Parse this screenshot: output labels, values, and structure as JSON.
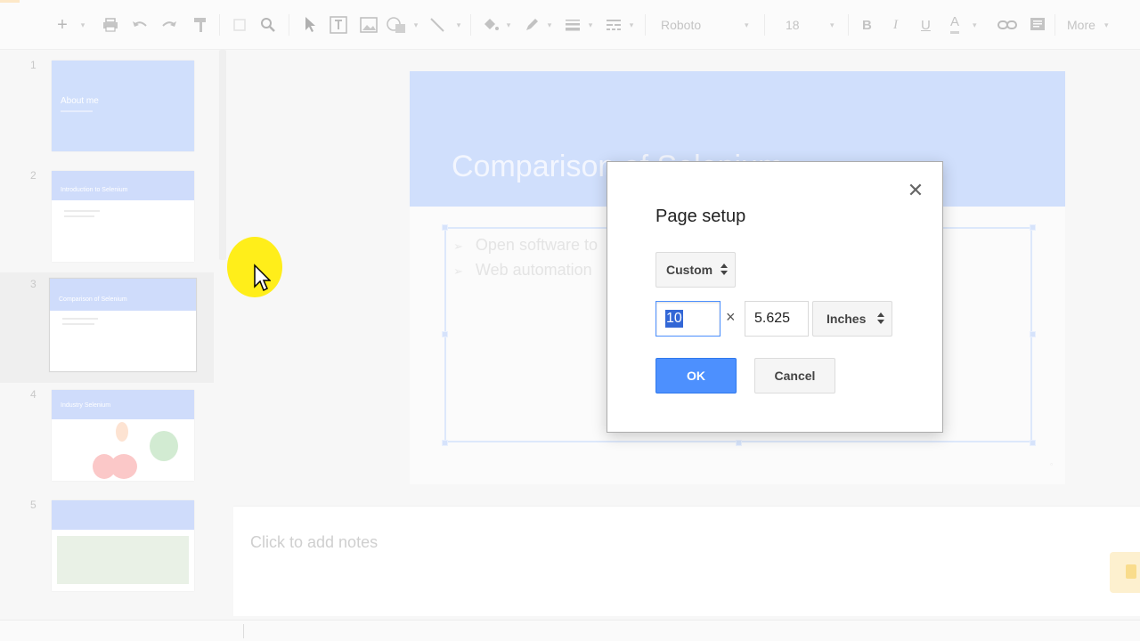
{
  "toolbar": {
    "font_name": "Roboto",
    "font_size": "18",
    "bold_label": "B",
    "italic_label": "I",
    "underline_label": "U",
    "textcolor_label": "A",
    "more_label": "More",
    "icons": [
      "new-slide-icon",
      "print-icon",
      "undo-icon",
      "redo-icon",
      "paint-format-icon",
      "fit-icon",
      "zoom-icon",
      "select-icon",
      "textbox-icon",
      "image-icon",
      "shape-icon",
      "line-icon",
      "fill-color-icon",
      "border-color-icon",
      "border-weight-icon",
      "border-dash-icon",
      "link-icon",
      "comment-icon"
    ]
  },
  "filmstrip": {
    "slides": [
      {
        "number": "1",
        "title": "About me"
      },
      {
        "number": "2",
        "title": "Introduction to Selenium"
      },
      {
        "number": "3",
        "title": "Comparison of Selenium"
      },
      {
        "number": "4",
        "title": "Industry Selenium"
      },
      {
        "number": "5",
        "title": ""
      }
    ],
    "selected_index": 2
  },
  "slide": {
    "title": "Comparison of Selenium",
    "bullets": [
      "Open software to",
      "Web automation"
    ]
  },
  "notes": {
    "placeholder": "Click to add notes"
  },
  "dialog": {
    "title": "Page setup",
    "close_glyph": "✕",
    "preset_label": "Custom",
    "width_value": "10",
    "times_glyph": "×",
    "height_value": "5.625",
    "unit_label": "Inches",
    "ok_label": "OK",
    "cancel_label": "Cancel"
  },
  "colors": {
    "accent": "#4d90fe",
    "slide_header": "#d0dffc",
    "cursor_highlight": "#ffee1a"
  }
}
